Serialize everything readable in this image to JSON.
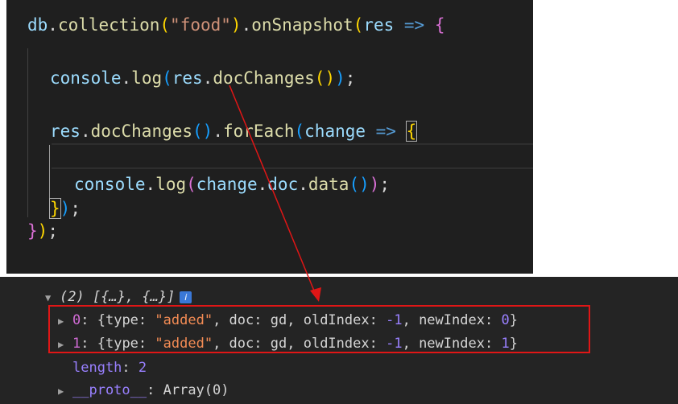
{
  "code": {
    "l1": {
      "obj": "db",
      "dot1": ".",
      "method1": "collection",
      "open1": "(",
      "str": "\"food\"",
      "close1": ")",
      "dot2": ".",
      "method2": "onSnapshot",
      "open2": "(",
      "param": "res",
      "arrow": " => ",
      "brace": "{"
    },
    "l2": {
      "obj": "console",
      "dot1": ".",
      "method1": "log",
      "open1": "(",
      "arg": "res",
      "dot2": ".",
      "method2": "docChanges",
      "inner": "()",
      "close1": ")",
      "semi": ";"
    },
    "l3": {
      "obj": "res",
      "dot1": ".",
      "method1": "docChanges",
      "inner": "()",
      "dot2": ".",
      "method2": "forEach",
      "open1": "(",
      "param": "change",
      "arrow": " => ",
      "brace": "{"
    },
    "l4": {
      "obj": "console",
      "dot1": ".",
      "method1": "log",
      "open1": "(",
      "a1": "change",
      "dot2": ".",
      "a2": "doc",
      "dot3": ".",
      "method2": "data",
      "inner": "()",
      "close1": ")",
      "semi": ";"
    },
    "l5": {
      "brace": "}",
      "close": ")",
      "semi": ";"
    },
    "l6": {
      "brace": "}",
      "close": ")",
      "semi": ";"
    }
  },
  "console": {
    "summary": {
      "count": "(2)",
      "preview": " [{…}, {…}]",
      "info": "i"
    },
    "items": [
      {
        "index": "0",
        "type_key": "type",
        "type_val": "\"added\"",
        "doc_key": "doc",
        "doc_val": "gd",
        "old_key": "oldIndex",
        "old_val": "-1",
        "new_key": "newIndex",
        "new_val": "0"
      },
      {
        "index": "1",
        "type_key": "type",
        "type_val": "\"added\"",
        "doc_key": "doc",
        "doc_val": "gd",
        "old_key": "oldIndex",
        "old_val": "-1",
        "new_key": "newIndex",
        "new_val": "1"
      }
    ],
    "length": {
      "key": "length",
      "val": "2"
    },
    "proto": {
      "key": "__proto__",
      "val": "Array(0)"
    }
  },
  "annotation": {
    "arrow_color": "#e01616",
    "box_color": "#e01616"
  }
}
